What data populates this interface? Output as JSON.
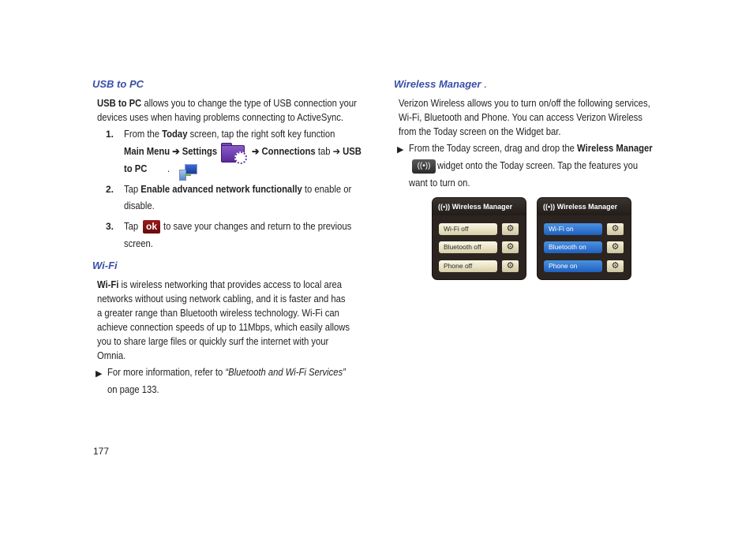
{
  "page_number": "177",
  "left": {
    "usb_heading": "USB to PC",
    "usb_intro_bold": "USB to PC",
    "usb_intro_line1": " allows you to change the type of USB connection your",
    "usb_intro_line2": "devices uses when having problems connecting to ActiveSync.",
    "steps": [
      {
        "num": "1.",
        "line1_a": "From the ",
        "line1_b": "Today",
        "line1_c": " screen, tap the right soft key function",
        "line2_a": "Main Menu ➔ Settings",
        "line2_b": "➔ Connections",
        "line2_c": " tab ➔ ",
        "line2_d": "USB",
        "line3_a": "to PC",
        "line3_b": "."
      },
      {
        "num": "2.",
        "line1_a": "Tap ",
        "line1_b": "Enable advanced network functionally",
        "line1_c": " to enable or",
        "line2": "disable."
      },
      {
        "num": "3.",
        "line1_a": "Tap ",
        "ok_label": "ok",
        "line1_c": " to save your changes and return to the previous",
        "line2": "screen."
      }
    ],
    "wifi_heading": "Wi-Fi",
    "wifi_lines": [
      "is wireless networking that provides access to local area",
      "networks without using network cabling, and it is faster and has",
      "a greater range than Bluetooth wireless technology. Wi-Fi can",
      "achieve connection speeds of up to 11Mbps, which easily allows",
      "you to share large files or quickly surf the internet with your",
      "Omnia."
    ],
    "wifi_bold": "Wi-Fi",
    "bullet_a": "For more information, refer to ",
    "bullet_link": "“Bluetooth and Wi-Fi Services”",
    "bullet_line2": "on page 133."
  },
  "right": {
    "heading": "Wireless Manager",
    "heading_suffix": " .",
    "intro_lines": [
      "Verizon Wireless allows you to turn on/off the following services,",
      "Wi-Fi, Bluetooth and Phone. You can access Verizon Wireless",
      "from the Today screen on the Widget bar."
    ],
    "bullet_a": "From the Today screen, drag and drop the ",
    "bullet_b": "Wireless Manager",
    "bullet_line2": " widget onto the Today screen. Tap the features you",
    "bullet_line3": "want to turn on.",
    "widgets": [
      {
        "title": "Wireless Manager",
        "items": [
          {
            "label": "Wi-Fi off",
            "state": "off"
          },
          {
            "label": "Bluetooth off",
            "state": "off"
          },
          {
            "label": "Phone off",
            "state": "off"
          }
        ]
      },
      {
        "title": "Wireless Manager",
        "items": [
          {
            "label": "Wi-Fi on",
            "state": "on"
          },
          {
            "label": "Bluetooth on",
            "state": "on"
          },
          {
            "label": "Phone on",
            "state": "on"
          }
        ]
      }
    ],
    "colors": {
      "heading": "#3a4fa8",
      "on": "#2f78d0",
      "off": "#ebe3c2",
      "widget_bg": "#2b2420"
    }
  },
  "icons": {
    "antenna": "((ᴟ))",
    "gear": "⚙",
    "triangle": "▶"
  }
}
